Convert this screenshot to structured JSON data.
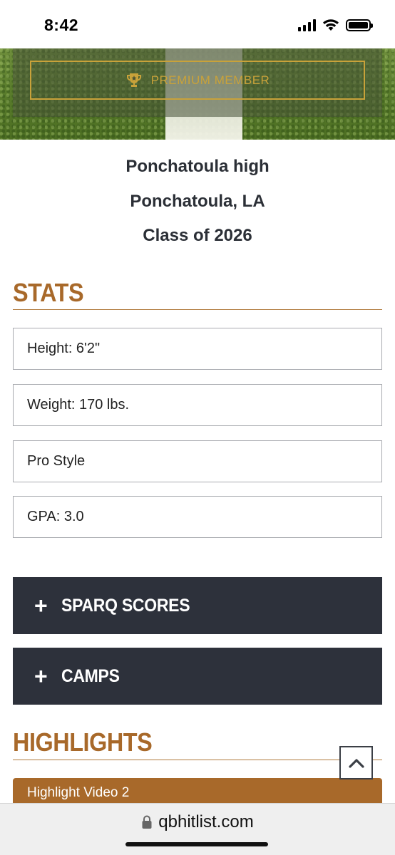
{
  "status_bar": {
    "time": "8:42"
  },
  "hero": {
    "badge_label": "PREMIUM MEMBER"
  },
  "profile": {
    "school": "Ponchatoula high",
    "location": "Ponchatoula, LA",
    "class_year": "Class of 2026"
  },
  "stats": {
    "title": "STATS",
    "items": [
      "Height: 6'2\"",
      "Weight: 170 lbs.",
      "Pro Style",
      "GPA: 3.0"
    ]
  },
  "accordions": [
    {
      "icon": "plus-icon",
      "label": "SPARQ SCORES"
    },
    {
      "icon": "plus-icon",
      "label": "CAMPS"
    }
  ],
  "highlights": {
    "title": "HIGHLIGHTS",
    "video_label": "Highlight Video 2"
  },
  "browser": {
    "url": "qbhitlist.com"
  },
  "colors": {
    "accent": "#a8692a",
    "gold": "#c9a23a",
    "dark_bar": "#2d313b"
  }
}
